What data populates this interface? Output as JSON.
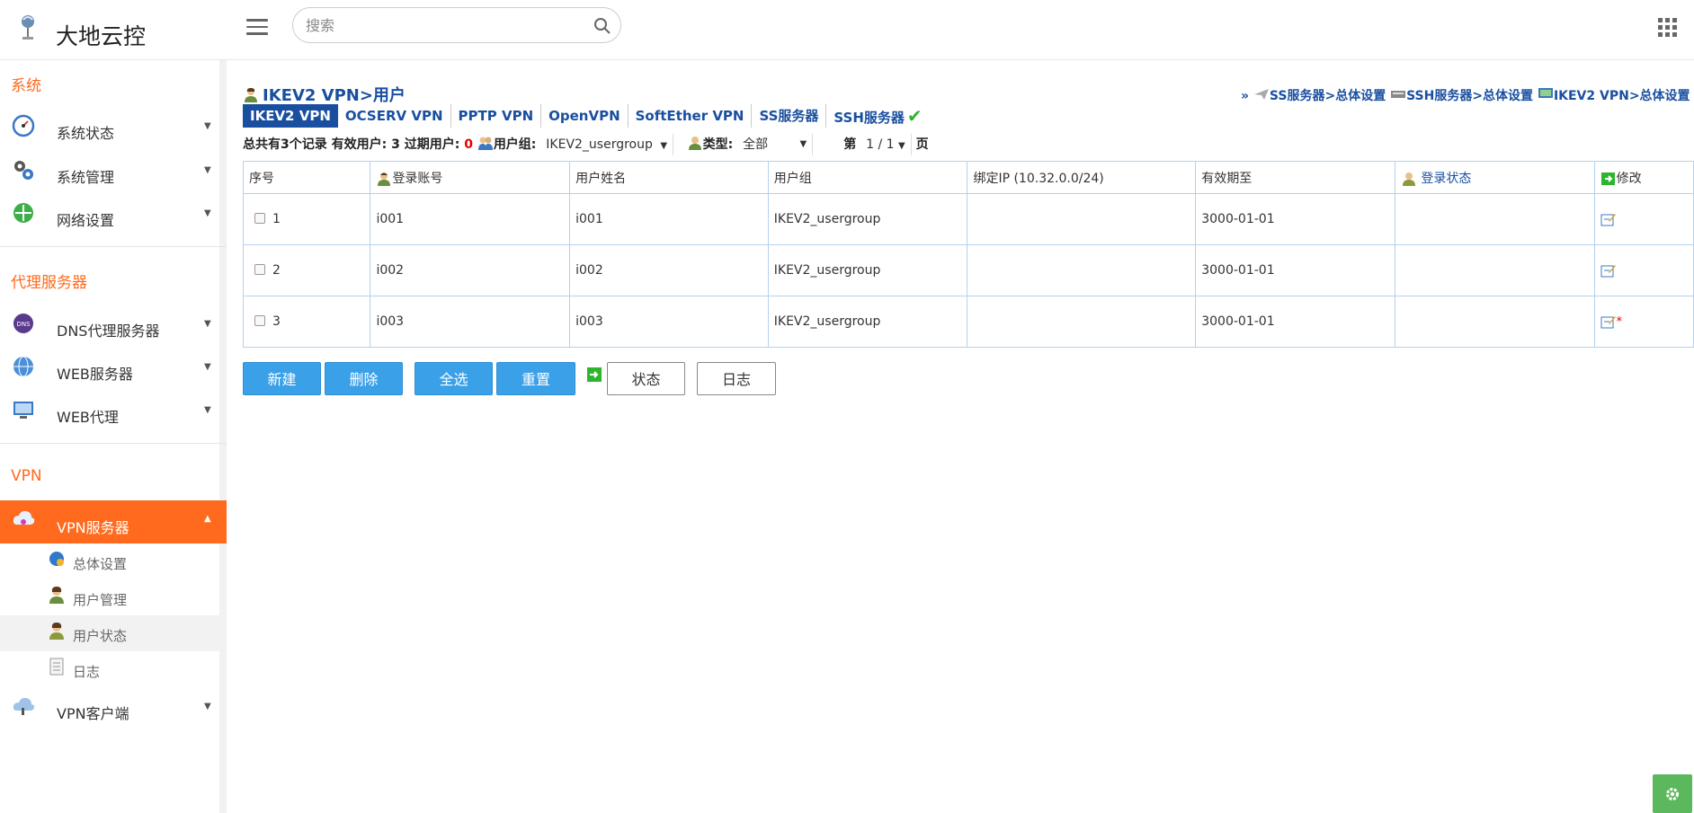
{
  "header": {
    "app_title": "大地云控",
    "search_placeholder": "搜索"
  },
  "sidebar": {
    "sections": {
      "system": "系统",
      "proxy": "代理服务器",
      "vpn": "VPN"
    },
    "items": {
      "system_status": "系统状态",
      "system_manage": "系统管理",
      "network_settings": "网络设置",
      "dns_proxy": "DNS代理服务器",
      "web_server": "WEB服务器",
      "web_proxy": "WEB代理",
      "vpn_server": "VPN服务器",
      "vpn_client": "VPN客户端"
    },
    "vpn_sub": {
      "overall": "总体设置",
      "user_manage": "用户管理",
      "user_status": "用户状态",
      "log": "日志"
    }
  },
  "main": {
    "breadcrumb": "IKEV2 VPN>用户",
    "right_links": {
      "prefix": "»",
      "ss": "SS服务器>总体设置",
      "ssh": "SSH服务器>总体设置",
      "ikev2": "IKEV2 VPN>总体设置"
    },
    "tabs": [
      "IKEV2 VPN",
      "OCSERV VPN",
      "PPTP VPN",
      "OpenVPN",
      "SoftEther VPN",
      "SS服务器",
      "SSH服务器"
    ],
    "filter": {
      "summary_prefix": "总共有3个记录 有效用户: 3  过期用户: ",
      "expired": "0",
      "group_label": "用户组:",
      "group_value": "IKEV2_usergroup",
      "type_label": "类型:",
      "type_value": "全部",
      "page_prefix": "第",
      "page_value": "1 / 1",
      "page_suffix": "页"
    },
    "table": {
      "headers": {
        "no": "序号",
        "account": "登录账号",
        "name": "用户姓名",
        "group": "用户组",
        "ip": "绑定IP (10.32.0.0/24)",
        "expire": "有效期至",
        "login_status": "登录状态",
        "edit": "修改"
      },
      "rows": [
        {
          "no": "1",
          "account": "i001",
          "name": "i001",
          "group": "IKEV2_usergroup",
          "ip": "",
          "expire": "3000-01-01",
          "login": "",
          "star": ""
        },
        {
          "no": "2",
          "account": "i002",
          "name": "i002",
          "group": "IKEV2_usergroup",
          "ip": "",
          "expire": "3000-01-01",
          "login": "",
          "star": ""
        },
        {
          "no": "3",
          "account": "i003",
          "name": "i003",
          "group": "IKEV2_usergroup",
          "ip": "",
          "expire": "3000-01-01",
          "login": "",
          "star": "*"
        }
      ]
    },
    "buttons": {
      "new": "新建",
      "delete": "删除",
      "select_all": "全选",
      "reset": "重置",
      "status": "状态",
      "log": "日志"
    }
  },
  "colors": {
    "accent": "#ff6a1e",
    "link": "#1a4fa0",
    "button_blue": "#3aa0e8",
    "gear_green": "#5cb85c"
  }
}
